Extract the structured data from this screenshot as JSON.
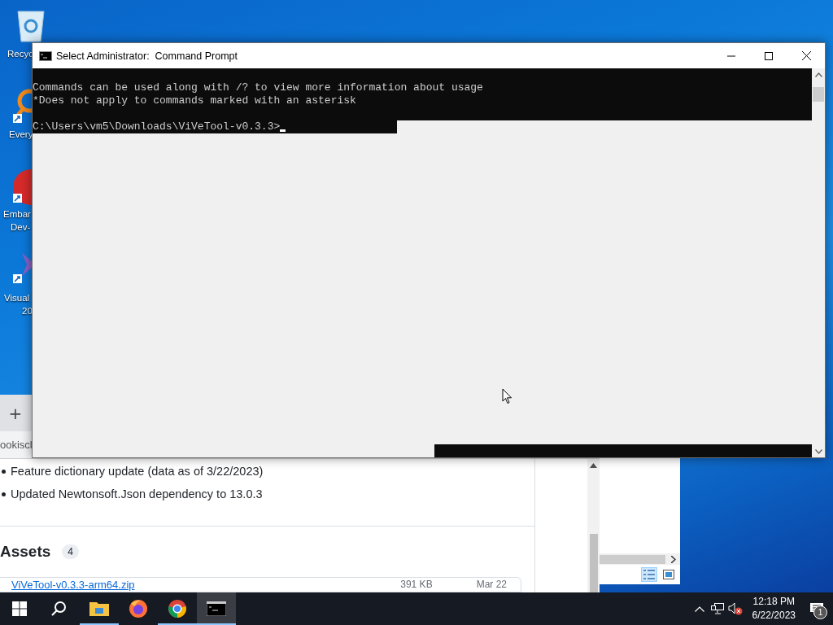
{
  "desktop_icons": [
    {
      "kind": "recycle_bin",
      "lines": [
        "Recyc"
      ]
    },
    {
      "kind": "magnifier_app",
      "lines": [
        "Every"
      ]
    },
    {
      "kind": "red_app",
      "lines": [
        "Embar",
        "Dev-"
      ]
    },
    {
      "kind": "purple_app",
      "lines": [
        "Visual",
        "20"
      ]
    }
  ],
  "browser_window": {
    "new_tab": "+",
    "address_text": "ookiscl",
    "release_notes": [
      "Feature dictionary update (data as of 3/22/2023)",
      "Updated Newtonsoft.Json dependency to 13.0.3"
    ],
    "assets_heading": "Assets",
    "assets_count": "4",
    "assets": [
      {
        "name": "ViVeTool-v0.3.3-arm64.zip",
        "size": "391 KB",
        "date": "Mar 22"
      }
    ]
  },
  "console_window": {
    "title": "Select Administrator:  Command Prompt",
    "output": [
      "Commands can be used along with /? to view more information about usage",
      "*Does not apply to commands marked with an asterisk"
    ],
    "prompt": "C:\\Users\\vm5\\Downloads\\ViVeTool-v0.3.3>"
  },
  "taskbar": {
    "apps": [
      {
        "kind": "start",
        "running": false,
        "selected": false
      },
      {
        "kind": "search",
        "running": false,
        "selected": false
      },
      {
        "kind": "explorer",
        "running": true,
        "selected": false
      },
      {
        "kind": "firefox",
        "running": false,
        "selected": false
      },
      {
        "kind": "chrome",
        "running": true,
        "selected": false
      },
      {
        "kind": "console",
        "running": true,
        "selected": true
      }
    ],
    "clock": {
      "time": "12:18 PM",
      "date": "6/22/2023"
    },
    "notification_count": "1"
  }
}
